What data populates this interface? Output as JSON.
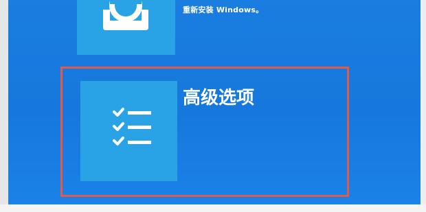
{
  "top_option": {
    "icon": "restore-icon",
    "description": "重新安装 Windows。"
  },
  "advanced_option": {
    "icon": "checklist-icon",
    "title": "高级选项"
  },
  "colors": {
    "background": "#1a7de0",
    "tile": "#2aa3e6",
    "highlight_border": "#e35a47",
    "text": "#ffffff"
  }
}
